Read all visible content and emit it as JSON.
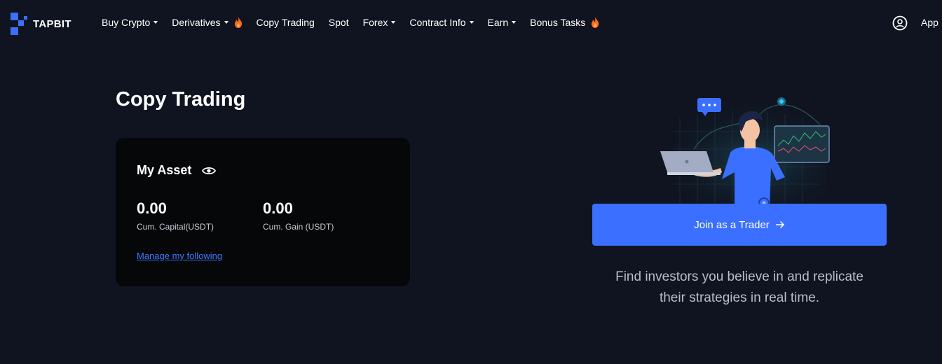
{
  "brand": {
    "name": "TAPBIT"
  },
  "nav": {
    "items": [
      {
        "label": "Buy Crypto",
        "dropdown": true
      },
      {
        "label": "Derivatives",
        "dropdown": true,
        "hot": true
      },
      {
        "label": "Copy Trading"
      },
      {
        "label": "Spot"
      },
      {
        "label": "Forex",
        "dropdown": true
      },
      {
        "label": "Contract Info",
        "dropdown": true
      },
      {
        "label": "Earn",
        "dropdown": true
      },
      {
        "label": "Bonus Tasks",
        "hot": true
      }
    ],
    "app_label": "App"
  },
  "page": {
    "title": "Copy Trading"
  },
  "asset": {
    "title": "My Asset",
    "capital_value": "0.00",
    "capital_label": "Cum. Capital(USDT)",
    "gain_value": "0.00",
    "gain_label": "Cum. Gain (USDT)",
    "manage_link": "Manage my following"
  },
  "cta": {
    "button_label": "Join as a Trader",
    "tagline_line1": "Find investors you believe in and replicate",
    "tagline_line2": "their strategies in real time."
  },
  "colors": {
    "background": "#0f1420",
    "card": "#060709",
    "accent": "#3b6fff",
    "link": "#3d7bff",
    "hot": "#ff6a1a"
  },
  "icons": {
    "logo": "tapbit-logo-icon",
    "hot": "flame-icon",
    "user": "user-circle-icon",
    "eye": "eye-icon",
    "arrow": "arrow-right-icon"
  }
}
